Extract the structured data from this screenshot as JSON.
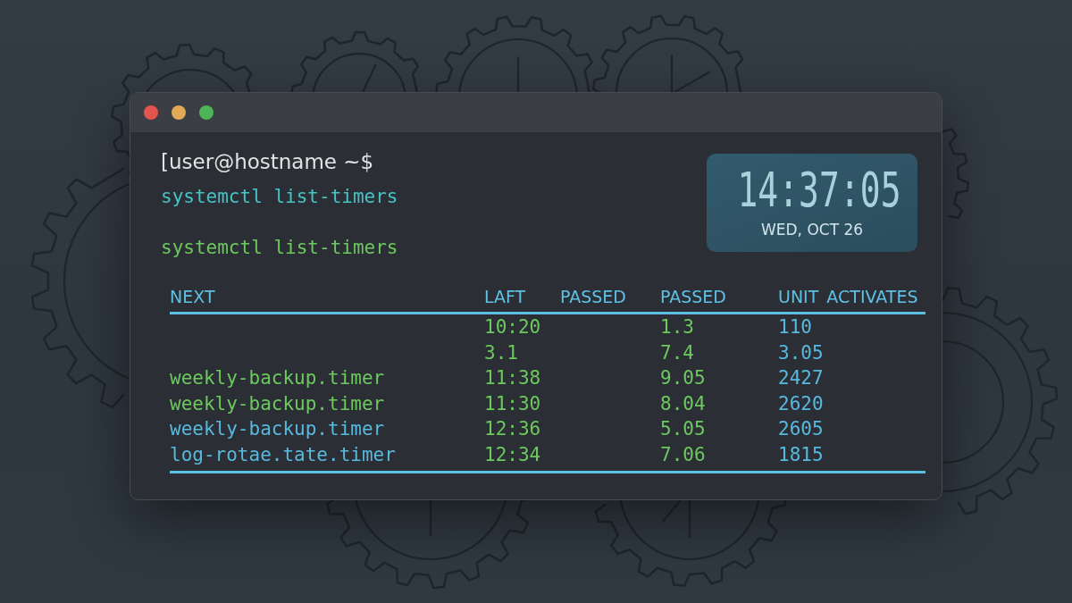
{
  "terminal": {
    "prompt": "[user@hostname ~$",
    "commands": [
      {
        "text": "systemctl list-timers",
        "color": "#46c3c6"
      },
      {
        "text": "systemctl list-timers",
        "color": "#6cc95e"
      }
    ]
  },
  "clock": {
    "time": "14:37:05",
    "date": "WED, OCT 26"
  },
  "table": {
    "columns": [
      "NEXT",
      "LAFT",
      "PASSED",
      "PASSED",
      "UNIT ACTIVATES"
    ],
    "rows": [
      {
        "cells": [
          null,
          "10:20",
          null,
          "1.3",
          "110"
        ]
      },
      {
        "cells": [
          null,
          "3.1",
          null,
          "7.4",
          "3.05"
        ]
      },
      {
        "cells": [
          "weekly-backup.timer",
          "11:38",
          null,
          "9.05",
          "2427"
        ],
        "color": "#6cc95e"
      },
      {
        "cells": [
          "weekly-backup.timer",
          "11:30",
          null,
          "8.04",
          "2620"
        ],
        "color": "#6cc95e"
      },
      {
        "cells": [
          "weekly-backup.timer",
          "12:36",
          null,
          "5.05",
          "2605"
        ],
        "color": "#58b9de"
      },
      {
        "cells": [
          "log-rotae.tate.timer",
          "12:34",
          null,
          "7.06",
          "1815"
        ],
        "color": "#58b9de"
      }
    ]
  }
}
